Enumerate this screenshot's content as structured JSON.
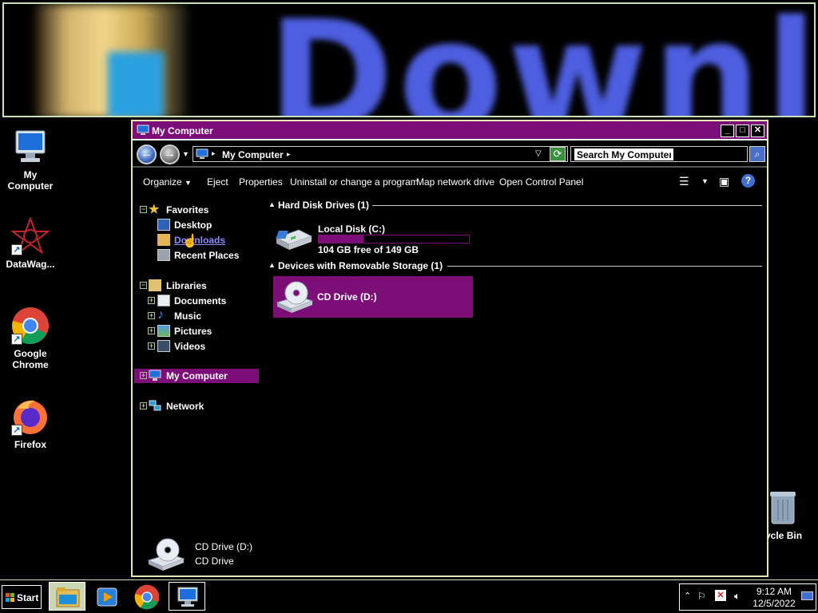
{
  "desktop": {
    "icons": [
      {
        "label": "My Computer"
      },
      {
        "label": "DataWag..."
      },
      {
        "label": "Google Chrome"
      },
      {
        "label": "Firefox"
      },
      {
        "label": "ycle Bin"
      }
    ]
  },
  "window": {
    "title": "My Computer",
    "controls": {
      "minimize": "_",
      "maximize": "□",
      "close": "✕"
    },
    "address": {
      "location": "My Computer",
      "separator": "▸"
    },
    "search": {
      "placeholder": "Search My Computer"
    },
    "toolbar": {
      "items": [
        "Organize",
        "Eject",
        "Properties",
        "Uninstall or change a program",
        "Map network drive",
        "Open Control Panel"
      ]
    },
    "nav": {
      "favorites": "Favorites",
      "desktop": "Desktop",
      "downloads": "Downloads",
      "recent_places": "Recent Places",
      "libraries": "Libraries",
      "documents": "Documents",
      "music": "Music",
      "pictures": "Pictures",
      "videos": "Videos",
      "my_computer": "My Computer",
      "network": "Network"
    },
    "content": {
      "hdd_group": "Hard Disk Drives (1)",
      "removable_group": "Devices with Removable Storage (1)",
      "local_disk": {
        "label": "Local Disk (C:)",
        "free_text": "104 GB free of 149 GB",
        "used_fraction": 0.3
      },
      "cd_drive": {
        "label": "CD Drive (D:)"
      }
    },
    "details": {
      "name": "CD Drive (D:)",
      "type": "CD Drive"
    }
  },
  "taskbar": {
    "start_label": "Start",
    "clock_time": "9:12 AM",
    "clock_date": "12/5/2022"
  },
  "colors": {
    "accent": "#7b0f77",
    "border": "#e7e6b6",
    "link": "#8c8cff"
  }
}
